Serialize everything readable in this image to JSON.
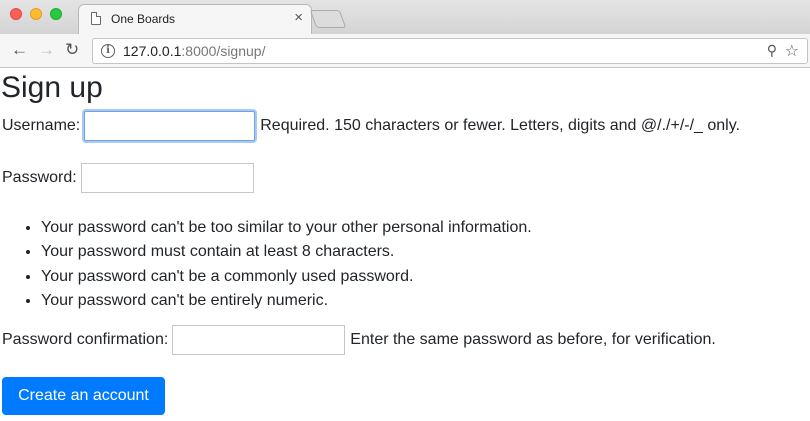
{
  "browser": {
    "tab_title": "One Boards",
    "tab_close": "×",
    "url_host": "127.0.0.1",
    "url_rest": ":8000/signup/",
    "icons": {
      "back": "arrow-left-icon",
      "forward": "arrow-right-icon",
      "reload": "reload-icon",
      "info": "info-icon",
      "key": "key-icon",
      "bookmark": "star-icon"
    }
  },
  "page": {
    "title": "Sign up",
    "username": {
      "label": "Username:",
      "value": "",
      "help": "Required. 150 characters or fewer. Letters, digits and @/./+/-/_ only."
    },
    "password": {
      "label": "Password:",
      "value": "",
      "rules": [
        "Your password can't be too similar to your other personal information.",
        "Your password must contain at least 8 characters.",
        "Your password can't be a commonly used password.",
        "Your password can't be entirely numeric."
      ]
    },
    "password_confirmation": {
      "label": "Password confirmation:",
      "value": "",
      "help": "Enter the same password as before, for verification."
    },
    "submit_label": "Create an account",
    "colors": {
      "primary": "#007bff",
      "focus_ring": "#a9c9f2"
    }
  }
}
